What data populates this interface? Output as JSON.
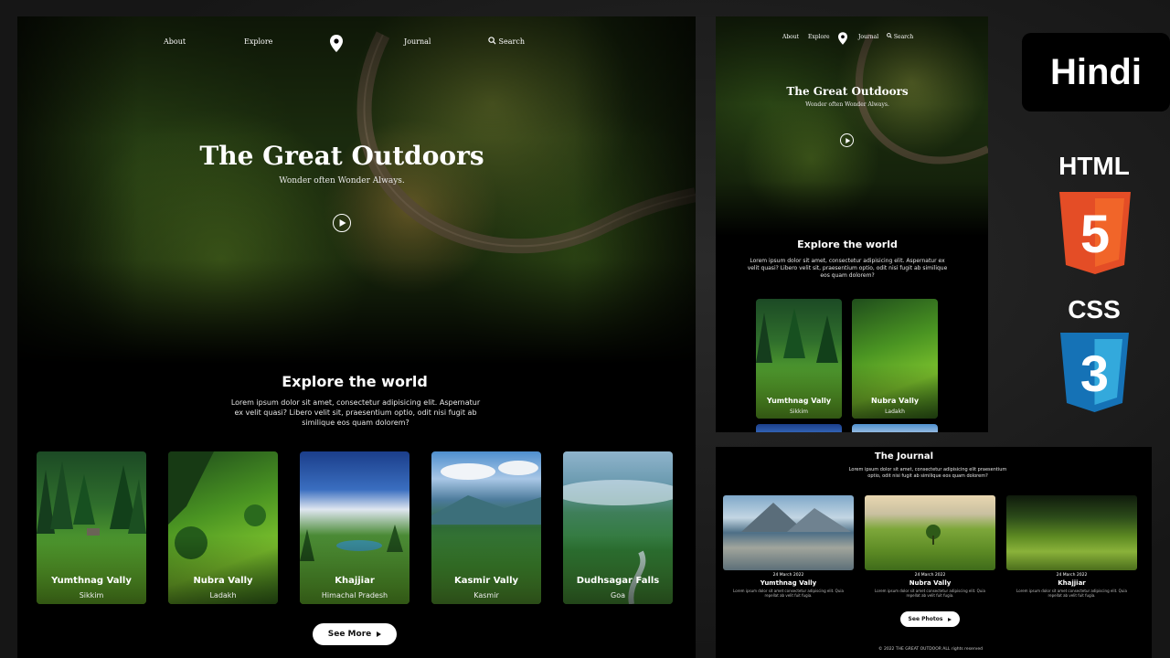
{
  "desktop": {
    "nav": {
      "about": "About",
      "explore": "Explore",
      "journal": "Journal",
      "search": "Search"
    },
    "hero": {
      "title": "The Great Outdoors",
      "subtitle": "Wonder often Wonder Always."
    },
    "explore": {
      "title": "Explore the world",
      "text": "Lorem ipsum dolor sit amet, consectetur adipisicing elit. Aspernatur ex velit quasi? Libero velit sit, praesentium optio, odit nisi fugit ab similique eos quam dolorem?"
    },
    "cards": [
      {
        "name": "Yumthnag Vally",
        "location": "Sikkim"
      },
      {
        "name": "Nubra Vally",
        "location": "Ladakh"
      },
      {
        "name": "Khajjiar",
        "location": "Himachal Pradesh"
      },
      {
        "name": "Kasmir Vally",
        "location": "Kasmir"
      },
      {
        "name": "Dudhsagar Falls",
        "location": "Goa"
      }
    ],
    "see_more": "See More"
  },
  "mobile": {
    "nav": {
      "about": "About",
      "explore": "Explore",
      "journal": "Journal",
      "search": "Search"
    },
    "hero": {
      "title": "The Great Outdoors",
      "subtitle": "Wonder often Wonder Always."
    },
    "explore": {
      "title": "Explore the world",
      "text": "Lorem ipsum dolor sit amet, consectetur adipisicing elit. Aspernatur ex velit quasi? Libero velit sit, praesentium optio, odit nisi fugit ab similique eos quam dolorem?"
    },
    "cards": [
      {
        "name": "Yumthnag Vally",
        "location": "Sikkim"
      },
      {
        "name": "Nubra Vally",
        "location": "Ladakh"
      }
    ]
  },
  "journal": {
    "title": "The Journal",
    "text": "Lorem ipsum dolor sit amet, consectetur adipisicing elit praesentium optio, odit nisi fugit ab similique eos quam dolorem?",
    "entries": [
      {
        "date": "24 March 2022",
        "name": "Yumthnag Vally",
        "desc": "Lorem ipsum dolor sit amet consectetur adipiscing elit. Quia repellat ab velit fuit fugia."
      },
      {
        "date": "24 March 2022",
        "name": "Nubra Vally",
        "desc": "Lorem ipsum dolor sit amet consectetur adipiscing elit. Quia repellat ab velit fuit fugia."
      },
      {
        "date": "24 March 2022",
        "name": "Khajjiar",
        "desc": "Lorem ipsum dolor sit amet consectetur adipiscing elit. Quia repellat ab velit fuit fugia."
      }
    ],
    "see_photos": "See Photos",
    "footer": "© 2022 THE GREAT OUTDOOR ALL rights reserved"
  },
  "badges": {
    "language": "Hindi",
    "html": "HTML",
    "html_number": "5",
    "css": "CSS",
    "css_number": "3"
  },
  "colors": {
    "html_orange": "#e44d26",
    "html_orange_light": "#f16529",
    "css_blue": "#1572b6",
    "css_blue_light": "#33a9dc",
    "background": "#000000"
  }
}
